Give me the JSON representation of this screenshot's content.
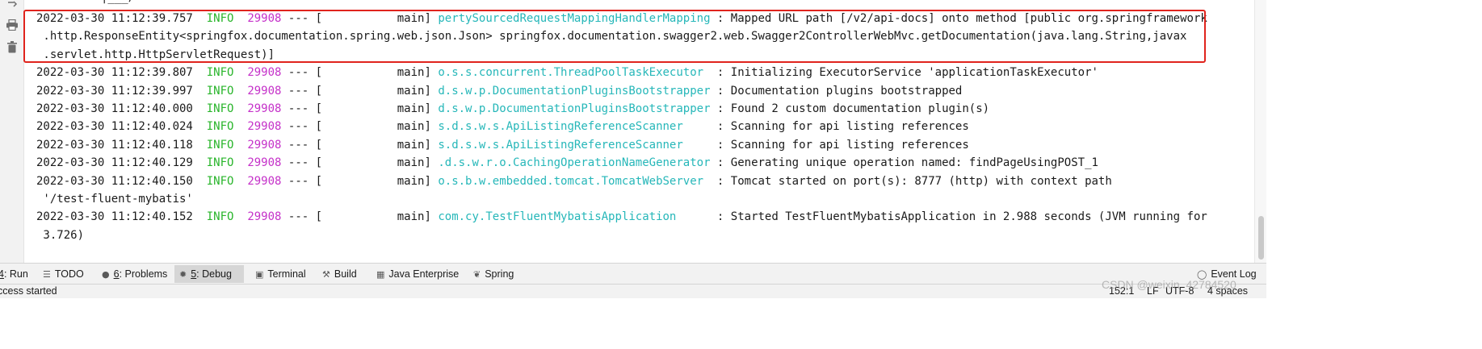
{
  "console": {
    "top_fragment": "|___/",
    "lines": [
      {
        "ts": "2022-03-30 11:12:39.757",
        "level": "INFO",
        "pid": "29908",
        "sep": " --- [           main] ",
        "logger": "pertySourcedRequestMappingHandlerMapping",
        "msg": " : Mapped URL path [/v2/api-docs] onto method [public org.springframework"
      },
      {
        "text": " .http.ResponseEntity<springfox.documentation.spring.web.json.Json> springfox.documentation.swagger2.web.Swagger2ControllerWebMvc.getDocumentation(java.lang.String,javax"
      },
      {
        "text": " .servlet.http.HttpServletRequest)]"
      },
      {
        "ts": "2022-03-30 11:12:39.807",
        "level": "INFO",
        "pid": "29908",
        "sep": " --- [           main] ",
        "logger": "o.s.s.concurrent.ThreadPoolTaskExecutor ",
        "msg": " : Initializing ExecutorService 'applicationTaskExecutor'"
      },
      {
        "ts": "2022-03-30 11:12:39.997",
        "level": "INFO",
        "pid": "29908",
        "sep": " --- [           main] ",
        "logger": "d.s.w.p.DocumentationPluginsBootstrapper",
        "msg": " : Documentation plugins bootstrapped"
      },
      {
        "ts": "2022-03-30 11:12:40.000",
        "level": "INFO",
        "pid": "29908",
        "sep": " --- [           main] ",
        "logger": "d.s.w.p.DocumentationPluginsBootstrapper",
        "msg": " : Found 2 custom documentation plugin(s)"
      },
      {
        "ts": "2022-03-30 11:12:40.024",
        "level": "INFO",
        "pid": "29908",
        "sep": " --- [           main] ",
        "logger": "s.d.s.w.s.ApiListingReferenceScanner    ",
        "msg": " : Scanning for api listing references"
      },
      {
        "ts": "2022-03-30 11:12:40.118",
        "level": "INFO",
        "pid": "29908",
        "sep": " --- [           main] ",
        "logger": "s.d.s.w.s.ApiListingReferenceScanner    ",
        "msg": " : Scanning for api listing references"
      },
      {
        "ts": "2022-03-30 11:12:40.129",
        "level": "INFO",
        "pid": "29908",
        "sep": " --- [           main] ",
        "logger": ".d.s.w.r.o.CachingOperationNameGenerator",
        "msg": " : Generating unique operation named: findPageUsingPOST_1"
      },
      {
        "ts": "2022-03-30 11:12:40.150",
        "level": "INFO",
        "pid": "29908",
        "sep": " --- [           main] ",
        "logger": "o.s.b.w.embedded.tomcat.TomcatWebServer ",
        "msg": " : Tomcat started on port(s): 8777 (http) with context path"
      },
      {
        "text": " '/test-fluent-mybatis'"
      },
      {
        "ts": "2022-03-30 11:12:40.152",
        "level": "INFO",
        "pid": "29908",
        "sep": " --- [           main] ",
        "logger": "com.cy.TestFluentMybatisApplication     ",
        "msg": " : Started TestFluentMybatisApplication in 2.988 seconds (JVM running for"
      },
      {
        "text": " 3.726)"
      }
    ]
  },
  "gutter_icons": [
    "scroll-to-end-icon",
    "print-icon",
    "trash-icon"
  ],
  "toolbar": {
    "tabs": [
      {
        "id": "run",
        "mnemonic": "4",
        "label": ": Run",
        "icon": "run-icon"
      },
      {
        "id": "todo",
        "mnemonic": "",
        "label": "TODO",
        "icon": "list-icon"
      },
      {
        "id": "problems",
        "mnemonic": "6",
        "label": ": Problems",
        "icon": "problems-icon"
      },
      {
        "id": "debug",
        "mnemonic": "5",
        "label": ": Debug",
        "icon": "bug-icon",
        "active": true
      },
      {
        "id": "terminal",
        "mnemonic": "",
        "label": "Terminal",
        "icon": "terminal-icon"
      },
      {
        "id": "build",
        "mnemonic": "",
        "label": "Build",
        "icon": "hammer-icon"
      },
      {
        "id": "java-enterprise",
        "mnemonic": "",
        "label": "Java Enterprise",
        "icon": "java-enterprise-icon"
      },
      {
        "id": "spring",
        "mnemonic": "",
        "label": "Spring",
        "icon": "spring-leaf-icon"
      }
    ],
    "event_log": "Event Log"
  },
  "status": {
    "message": "ccess started",
    "position": "152:1",
    "line_sep": "LF",
    "encoding": "UTF-8",
    "indent": "4 spaces"
  },
  "watermark": "CSDN @weixin_42784520",
  "colors": {
    "timestamp": "#1a1a1a",
    "level_info": "#29b52b",
    "pid": "#c531c9",
    "logger": "#26b7b9",
    "highlight_border": "#e0241d",
    "active_tab_bg": "#d6d6d6"
  }
}
